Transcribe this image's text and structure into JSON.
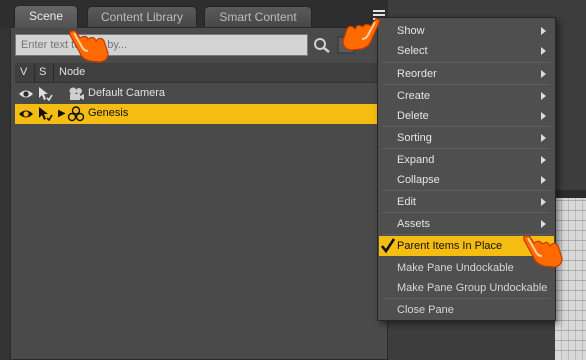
{
  "tabs": [
    {
      "label": "Scene",
      "active": true
    },
    {
      "label": "Content Library",
      "active": false
    },
    {
      "label": "Smart Content",
      "active": false
    }
  ],
  "search": {
    "placeholder": "Enter text to filter by..."
  },
  "columns": {
    "v": "V",
    "s": "S",
    "node": "Node"
  },
  "tree": [
    {
      "label": "Default Camera",
      "icon": "camera-icon",
      "selected": false,
      "expandable": false
    },
    {
      "label": "Genesis",
      "icon": "figure-icon",
      "selected": true,
      "expandable": true
    }
  ],
  "context_menu": {
    "items": [
      {
        "label": "Show",
        "submenu": true
      },
      {
        "label": "Select",
        "submenu": true
      },
      {
        "label": "Reorder",
        "submenu": true
      },
      {
        "label": "Create",
        "submenu": true
      },
      {
        "label": "Delete",
        "submenu": true
      },
      {
        "label": "Sorting",
        "submenu": true
      },
      {
        "label": "Expand",
        "submenu": true
      },
      {
        "label": "Collapse",
        "submenu": true
      },
      {
        "label": "Edit",
        "submenu": true
      },
      {
        "label": "Assets",
        "submenu": true
      },
      {
        "label": "Parent Items In Place",
        "checked": true,
        "highlighted": true
      },
      {
        "label": "Make Pane Undockable"
      },
      {
        "label": "Make Pane Group Undockable"
      },
      {
        "label": "Close Pane"
      }
    ]
  },
  "colors": {
    "accent": "#f5bd12",
    "pointer": "#ff6a00",
    "panel": "#4a4a4a",
    "menu": "#4f4f4f"
  }
}
